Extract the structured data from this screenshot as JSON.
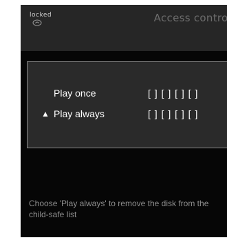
{
  "header": {
    "lock_label": "locked",
    "lock_icon": "lock-icon",
    "title": "Access control"
  },
  "options": [
    {
      "marker": "",
      "label": "Play once",
      "code": "[ ] [ ] [ ] [ ]"
    },
    {
      "marker": "▲",
      "label": "Play always",
      "code": "[ ] [ ] [ ] [ ]"
    }
  ],
  "help": {
    "text": "Choose 'Play always' to remove the disk from the child-safe list"
  }
}
